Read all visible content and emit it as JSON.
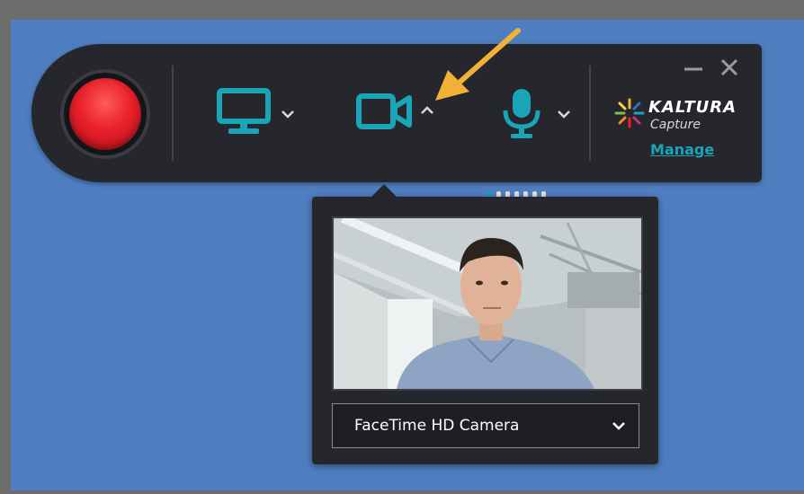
{
  "toolbar": {
    "record_label": "",
    "brand": {
      "name": "KALTURA",
      "sub": "Capture",
      "manage_label": "Manage"
    },
    "icons": {
      "screen": "monitor-icon",
      "camera": "video-camera-icon",
      "microphone": "microphone-icon",
      "minimize": "minimize-icon",
      "close": "close-icon"
    },
    "camera_dropdown_state": "open",
    "mic_level_bars": 7,
    "mic_level_active": 1
  },
  "camera_popover": {
    "selected_camera": "FaceTime HD Camera"
  },
  "colors": {
    "accent": "#1aa4b8",
    "toolbar_bg": "#26272c",
    "record": "#e8202a",
    "desktop": "#4f7ec0",
    "annotation_arrow": "#f0b135"
  }
}
